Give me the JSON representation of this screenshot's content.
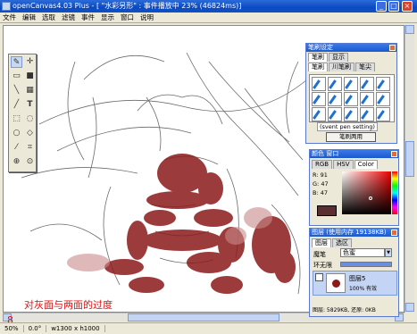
{
  "window": {
    "title": "openCanvas4.03 Plus - [ \"水彩另形\" : 事件播放中 23% (46824ms)]",
    "min": "_",
    "max": "□",
    "close": "×"
  },
  "menu": [
    "文件",
    "编辑",
    "选取",
    "滤镜",
    "事件",
    "显示",
    "窗口",
    "说明"
  ],
  "toolbox": {
    "tools": [
      "brush",
      "move",
      "eraser",
      "fill",
      "line",
      "blur",
      "pencil",
      "text",
      "select-rect",
      "select-lasso",
      "eyedropper",
      "crop",
      "zoom",
      "hand",
      "rotate",
      "view"
    ]
  },
  "brush_panel": {
    "title": "笔刷设定",
    "tabs": [
      "笔刷",
      "显示"
    ],
    "subtabs": [
      "笔刷",
      "川笔刷",
      "笔尖"
    ],
    "preset_label": "(svent pen setting)",
    "apply_button": "笔刷两用"
  },
  "color_panel": {
    "title": "颜色 窗口",
    "tabs": [
      "RGB",
      "HSV",
      "Color"
    ],
    "r_label": "R:",
    "r_value": "91",
    "g_label": "G:",
    "g_value": "47",
    "b_label": "B:",
    "b_value": "47",
    "swatch_color": "#5b2f2f"
  },
  "layer_panel": {
    "title": "图层 (使用内存 19138KB)",
    "tabs": [
      "图层",
      "选区"
    ],
    "mode_label": "魔笔",
    "mode_value": "色蜜",
    "opacity_label": "环无限",
    "layer_name": "图层5",
    "layer_opacity": "100% 有效",
    "footer": "图层: 5829KB, 还原: 0KB"
  },
  "status": {
    "zoom": "50%",
    "angle": "0.0°",
    "size": "w1300 x h1000"
  },
  "annotation": "对灰面与两面的过度",
  "mark": "8"
}
